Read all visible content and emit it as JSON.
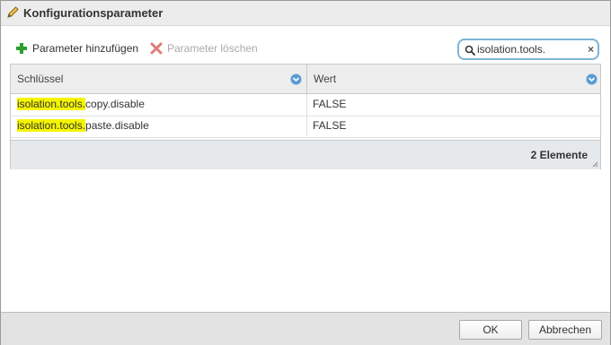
{
  "dialog": {
    "title": "Konfigurationsparameter",
    "title_icon": "pencil-icon"
  },
  "toolbar": {
    "add_label": "Parameter hinzufügen",
    "add_icon": "plus-icon",
    "add_icon_color": "#2e9e2e",
    "delete_label": "Parameter löschen",
    "delete_icon": "x-icon",
    "delete_icon_color": "#e07a7a",
    "delete_enabled": false
  },
  "search": {
    "value": "isolation.tools.",
    "search_icon": "search-icon",
    "clear_icon": "clear-icon",
    "clear_glyph": "×"
  },
  "grid": {
    "columns": [
      {
        "label": "Schlüssel",
        "sort_icon": "chevron-down-icon"
      },
      {
        "label": "Wert",
        "sort_icon": "chevron-down-icon"
      }
    ],
    "rows": [
      {
        "key_match": "isolation.tools.",
        "key_rest": "copy.disable",
        "value": "FALSE"
      },
      {
        "key_match": "isolation.tools.",
        "key_rest": "paste.disable",
        "value": "FALSE"
      }
    ],
    "footer_count": "2 Elemente",
    "highlight_color": "#f5f500"
  },
  "buttons": {
    "ok_label": "OK",
    "cancel_label": "Abbrechen"
  }
}
